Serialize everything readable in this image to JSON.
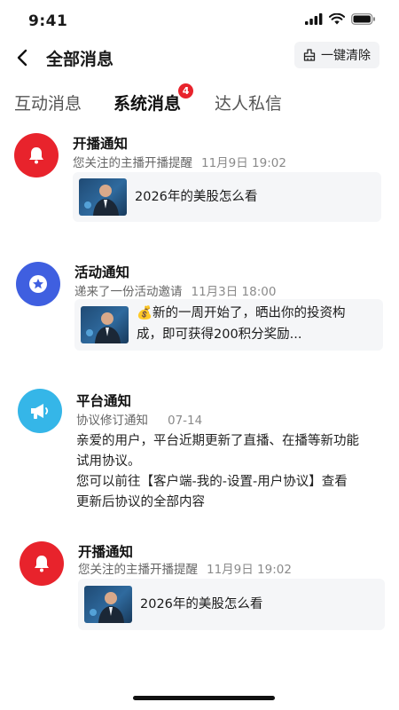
{
  "status": {
    "time": "9:41"
  },
  "header": {
    "title": "全部消息",
    "clear_label": "一键清除"
  },
  "tabs": [
    {
      "label": "互动消息"
    },
    {
      "label": "系统消息",
      "badge": "4"
    },
    {
      "label": "达人私信"
    }
  ],
  "messages": [
    {
      "title": "开播通知",
      "subtitle": "您关注的主播开播提醒",
      "time": "11月9日 19:02",
      "card_text": "2026年的美股怎么看"
    },
    {
      "title": "活动通知",
      "subtitle": "递来了一份活动邀请",
      "time": "11月3日 18:00",
      "card_line1": "💰新的一周开始了，晒出你的投资构",
      "card_line2": "成，即可获得200积分奖励..."
    },
    {
      "title": "平台通知",
      "subtitle": "协议修订通知",
      "time": "07-14",
      "body_line1": "亲爱的用户，平台近期更新了直播、在播等新功能",
      "body_line2": "试用协议。",
      "body_line3": "您可以前往【客户端-我的-设置-用户协议】查看",
      "body_line4": "更新后协议的全部内容"
    },
    {
      "title": "开播通知",
      "subtitle": "您关注的主播开播提醒",
      "time": "11月9日 19:02",
      "card_text": "2026年的美股怎么看"
    }
  ],
  "icons": {
    "bell": "bell-icon",
    "star": "star-icon",
    "megaphone": "megaphone-icon"
  },
  "colors": {
    "red": "#e8232c",
    "blue": "#3f5fe0",
    "cyan": "#35b6e8",
    "badge": "#e8232c"
  }
}
